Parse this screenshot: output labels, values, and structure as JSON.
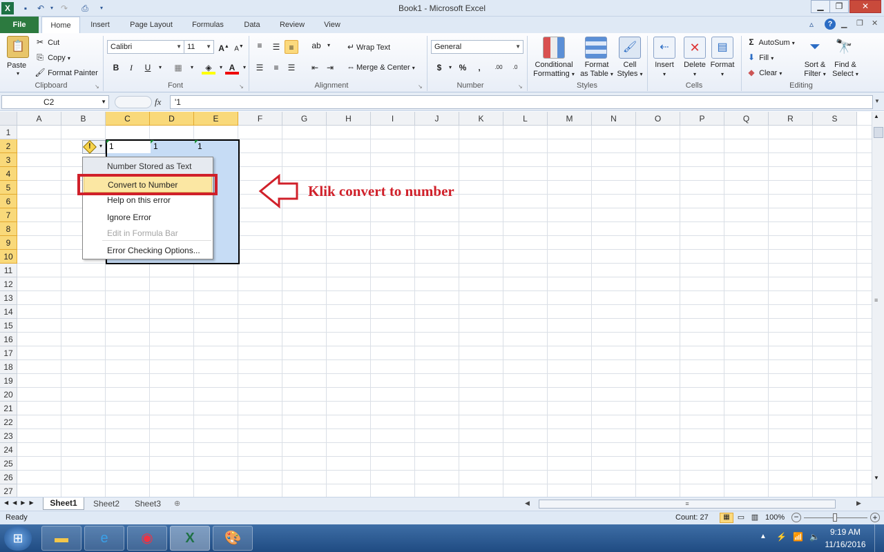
{
  "window": {
    "title": "Book1 - Microsoft Excel"
  },
  "tabs": [
    "File",
    "Home",
    "Insert",
    "Page Layout",
    "Formulas",
    "Data",
    "Review",
    "View"
  ],
  "ribbon": {
    "clipboard": {
      "paste": "Paste",
      "cut": "Cut",
      "copy": "Copy",
      "format_painter": "Format Painter",
      "label": "Clipboard"
    },
    "font": {
      "name": "Calibri",
      "size": "11",
      "label": "Font"
    },
    "alignment": {
      "wrap": "Wrap Text",
      "merge": "Merge & Center",
      "label": "Alignment"
    },
    "number": {
      "format": "General",
      "label": "Number"
    },
    "styles": {
      "cond1": "Conditional",
      "cond2": "Formatting",
      "fmt1": "Format",
      "fmt2": "as Table",
      "cell1": "Cell",
      "cell2": "Styles",
      "label": "Styles"
    },
    "cells": {
      "insert": "Insert",
      "delete": "Delete",
      "format": "Format",
      "label": "Cells"
    },
    "editing": {
      "autosum": "AutoSum",
      "fill": "Fill",
      "clear": "Clear",
      "sort1": "Sort &",
      "sort2": "Filter",
      "find1": "Find &",
      "find2": "Select",
      "label": "Editing"
    }
  },
  "formula_bar": {
    "name_box": "C2",
    "fx": "fx",
    "content": "'1"
  },
  "grid": {
    "columns": [
      "A",
      "B",
      "C",
      "D",
      "E",
      "F",
      "G",
      "H",
      "I",
      "J",
      "K",
      "L",
      "M",
      "N",
      "O",
      "P",
      "Q",
      "R",
      "S"
    ],
    "rows": [
      "1",
      "2",
      "3",
      "4",
      "5",
      "6",
      "7",
      "8",
      "9",
      "10",
      "11",
      "12",
      "13",
      "14",
      "15",
      "16",
      "17",
      "18",
      "19",
      "20",
      "21",
      "22",
      "23",
      "24",
      "25",
      "26",
      "27"
    ],
    "cell_values": {
      "C2": "1",
      "D2": "1",
      "E2": "1"
    }
  },
  "error_menu": {
    "header": "Number Stored as Text",
    "items": [
      "Convert to Number",
      "Help on this error",
      "Ignore Error",
      "Edit in Formula Bar",
      "Error Checking Options..."
    ]
  },
  "annotation": {
    "text": "Klik convert to number",
    "color": "#d0202a"
  },
  "sheets": [
    "Sheet1",
    "Sheet2",
    "Sheet3"
  ],
  "status": {
    "ready": "Ready",
    "count": "Count: 27",
    "zoom": "100%"
  },
  "taskbar": {
    "time": "9:19 AM",
    "date": "11/16/2016"
  },
  "colors": {
    "file_tab": "#2c7a3f",
    "selection": "#c6dcf5",
    "menu_highlight": "#fbe7a3",
    "red_box": "#d0202a"
  }
}
